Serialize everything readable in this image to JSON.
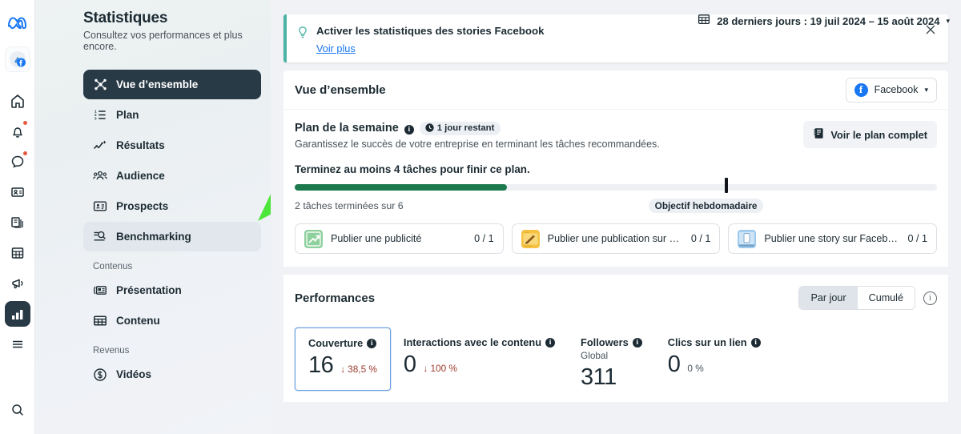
{
  "header": {
    "title": "Statistiques",
    "subtitle": "Consultez vos performances et plus encore.",
    "date_range": "28 derniers jours : 19 juil 2024 – 15 août 2024",
    "date_icon": "calendar-icon",
    "date_caret": "▾"
  },
  "rail": {
    "items": [
      {
        "name": "meta-logo",
        "glyph": "∞"
      },
      {
        "name": "business-account-avatar",
        "glyph": "avatar"
      },
      {
        "name": "home-icon",
        "glyph": "home"
      },
      {
        "name": "notifications-icon",
        "glyph": "bell",
        "badge": true
      },
      {
        "name": "messages-icon",
        "glyph": "chat",
        "badge": true
      },
      {
        "name": "contacts-icon",
        "glyph": "card"
      },
      {
        "name": "posts-icon",
        "glyph": "pages"
      },
      {
        "name": "calendar-grid-icon",
        "glyph": "grid"
      },
      {
        "name": "ads-icon",
        "glyph": "megaphone"
      },
      {
        "name": "insights-icon",
        "glyph": "bars",
        "active": true
      },
      {
        "name": "more-menu-icon",
        "glyph": "hamburger"
      },
      {
        "name": "search-icon",
        "glyph": "search"
      }
    ]
  },
  "sidebar": {
    "items": [
      {
        "label": "Vue d’ensemble",
        "icon": "overview-icon",
        "state": "active"
      },
      {
        "label": "Plan",
        "icon": "list-icon",
        "state": "normal"
      },
      {
        "label": "Résultats",
        "icon": "line-chart-icon",
        "state": "normal"
      },
      {
        "label": "Audience",
        "icon": "people-icon",
        "state": "normal"
      },
      {
        "label": "Prospects",
        "icon": "contact-card-icon",
        "state": "normal"
      },
      {
        "label": "Benchmarking",
        "icon": "benchmark-search-icon",
        "state": "hover"
      }
    ],
    "groups": [
      {
        "label": "Contenus",
        "items": [
          {
            "label": "Présentation",
            "icon": "presentation-icon"
          },
          {
            "label": "Contenu",
            "icon": "table-grid-icon"
          }
        ]
      },
      {
        "label": "Revenus",
        "items": [
          {
            "label": "Vidéos",
            "icon": "dollar-circle-icon"
          }
        ]
      }
    ]
  },
  "annotation": {
    "name": "green-arrow-annotation",
    "color": "#4ce63a",
    "points_to": "Benchmarking"
  },
  "banner": {
    "icon": "lightbulb-icon",
    "title": "Activer les statistiques des stories Facebook",
    "link": "Voir plus",
    "close_icon": "close-icon",
    "accent_color": "#4cb3a4"
  },
  "overview_strip": {
    "title": "Vue d’ensemble",
    "page_selector": {
      "icon": "facebook-icon",
      "label": "Facebook",
      "caret": "▾"
    }
  },
  "plan": {
    "title": "Plan de la semaine",
    "info_icon": "info-icon",
    "badge": {
      "icon": "clock-icon",
      "label": "1 jour restant"
    },
    "description": "Garantissez le succès de votre entreprise en terminant les tâches recommandées.",
    "full_plan_button": {
      "icon": "plan-book-icon",
      "label": "Voir le plan complet"
    },
    "goal_heading": "Terminez au moins 4 tâches pour finir ce plan.",
    "progress": {
      "completed": 2,
      "total": 6,
      "percent": 33,
      "marker_percent": 67
    },
    "progress_label": "2 tâches terminées sur 6",
    "goal_marker_label": "Objectif hebdomadaire",
    "progress_fill_color": "#1d7a4e",
    "tasks": [
      {
        "label": "Publier une publicité",
        "count": "0 / 1",
        "thumb": "ad-growth-thumbnail",
        "thumb_color": "#8fd19e"
      },
      {
        "label": "Publier une publication sur Face…",
        "count": "0 / 1",
        "thumb": "post-pencil-thumbnail",
        "thumb_color": "#f5c242"
      },
      {
        "label": "Publier une story sur Facebook",
        "count": "0 / 1",
        "thumb": "story-phone-thumbnail",
        "thumb_color": "#9dc9ec"
      }
    ]
  },
  "performance": {
    "title": "Performances",
    "segments": [
      {
        "label": "Par jour",
        "selected": true
      },
      {
        "label": "Cumulé",
        "selected": false
      }
    ],
    "info_icon": "info-circle-outline-icon",
    "metrics": [
      {
        "label": "Couverture",
        "info_icon": "info-icon",
        "sublabel": "",
        "value": "16",
        "delta": "38,5 %",
        "delta_arrow": "↓",
        "delta_direction": "down",
        "selected": true
      },
      {
        "label": "Interactions avec le contenu",
        "info_icon": "info-icon",
        "sublabel": "",
        "value": "0",
        "delta": "100 %",
        "delta_arrow": "↓",
        "delta_direction": "down",
        "selected": false
      },
      {
        "label": "Followers",
        "info_icon": "info-icon",
        "sublabel": "Global",
        "value": "311",
        "delta": "",
        "delta_arrow": "",
        "delta_direction": "none",
        "selected": false
      },
      {
        "label": "Clics sur un lien",
        "info_icon": "info-icon",
        "sublabel": "",
        "value": "0",
        "delta": "0 %",
        "delta_arrow": "",
        "delta_direction": "flat",
        "selected": false
      }
    ]
  },
  "colors": {
    "accent_blue": "#1877f2",
    "dark_navy": "#293a47",
    "progress_green": "#1d7a4e",
    "banner_teal": "#4cb3a4",
    "delta_red": "#9c3b2e",
    "annotation_green": "#4ce63a"
  }
}
